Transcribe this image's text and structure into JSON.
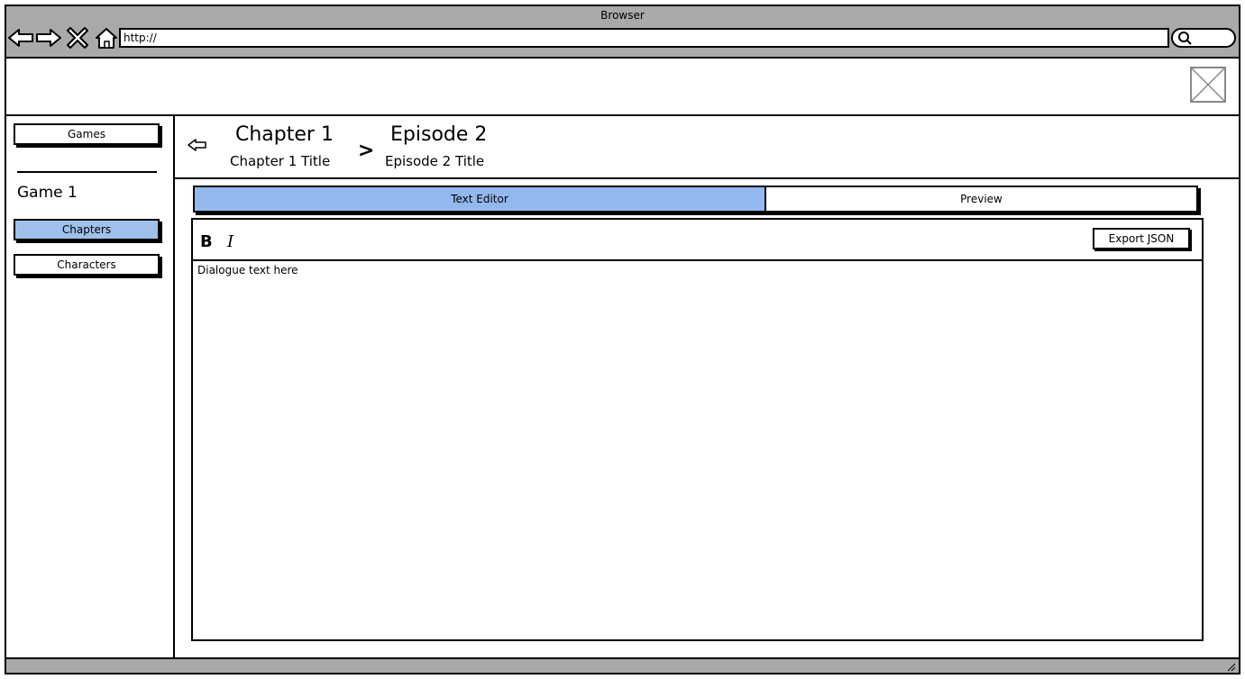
{
  "browser": {
    "title": "Browser",
    "url": "http://",
    "icons": [
      "back-arrow-icon",
      "forward-arrow-icon",
      "close-x-icon",
      "home-icon",
      "search-icon",
      "resize-grip-icon"
    ]
  },
  "header": {
    "logo_icon": "image-placeholder-icon"
  },
  "sidebar": {
    "games_label": "Games",
    "game_title": "Game 1",
    "items": [
      {
        "label": "Chapters",
        "active": true
      },
      {
        "label": "Characters",
        "active": false
      }
    ]
  },
  "breadcrumb": {
    "back_icon": "back-arrow-icon",
    "separator": ">",
    "chapter": {
      "title": "Chapter 1",
      "subtitle": "Chapter 1 Title"
    },
    "episode": {
      "title": "Episode 2",
      "subtitle": "Episode 2 Title"
    }
  },
  "tabs": [
    {
      "label": "Text Editor",
      "active": true
    },
    {
      "label": "Preview",
      "active": false
    }
  ],
  "editor": {
    "bold_label": "B",
    "italic_label": "I",
    "export_label": "Export JSON",
    "content": "Dialogue text here"
  },
  "colors": {
    "chrome": "#a9a8aa",
    "active_nav": "#9ec0ea",
    "active_tab": "#93b8ee"
  }
}
